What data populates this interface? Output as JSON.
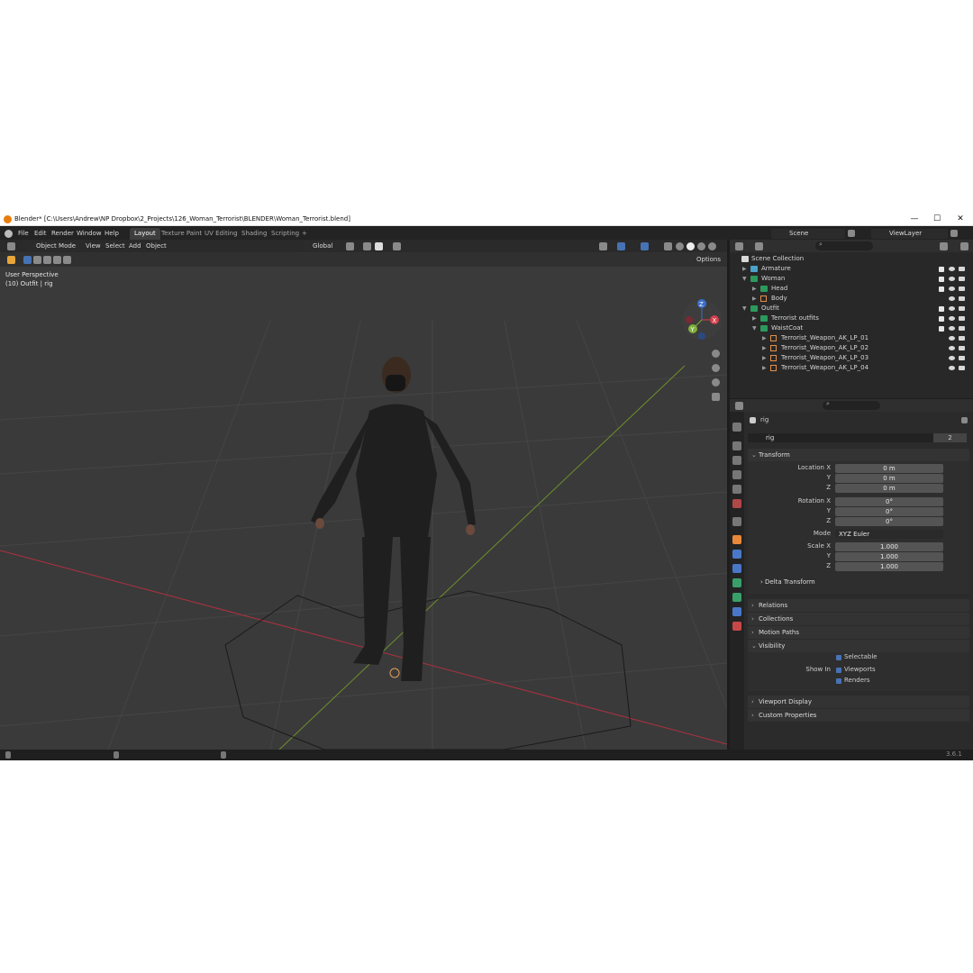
{
  "window": {
    "title": "Blender* [C:\\Users\\Andrew\\NP Dropbox\\2_Projects\\126_Woman_Terrorist\\BLENDER\\Woman_Terrorist.blend]",
    "minimize": "—",
    "maximize": "☐",
    "close": "✕"
  },
  "menubar": {
    "menus": [
      "File",
      "Edit",
      "Render",
      "Window",
      "Help"
    ],
    "tabs": [
      "Layout",
      "Texture Paint",
      "UV Editing",
      "Shading",
      "Scripting"
    ],
    "add_tab": "+",
    "scene": "Scene",
    "view_layer": "ViewLayer"
  },
  "viewport": {
    "mode": "Object Mode",
    "menus": [
      "View",
      "Select",
      "Add",
      "Object"
    ],
    "orientation": "Global",
    "options": "Options",
    "overlay_title": "User Perspective",
    "overlay_sub": "(10) Outfit | rig",
    "gizmo_axes": [
      "X",
      "Y",
      "Z"
    ]
  },
  "outliner": {
    "root": "Scene Collection",
    "items": [
      {
        "label": "Armature",
        "type": "armature"
      },
      {
        "label": "Woman",
        "type": "collection"
      },
      {
        "label": "Head",
        "type": "mesh"
      },
      {
        "label": "Body",
        "type": "mesh"
      },
      {
        "label": "Outfit",
        "type": "collection"
      },
      {
        "label": "Terrorist outfits",
        "type": "mesh"
      },
      {
        "label": "WaistCoat",
        "type": "collection"
      },
      {
        "label": "Terrorist_Weapon_AK_LP_01",
        "type": "mesh"
      },
      {
        "label": "Terrorist_Weapon_AK_LP_02",
        "type": "mesh"
      },
      {
        "label": "Terrorist_Weapon_AK_LP_03",
        "type": "mesh"
      },
      {
        "label": "Terrorist_Weapon_AK_LP_04",
        "type": "mesh"
      }
    ]
  },
  "properties": {
    "object_name": "rig",
    "data_name": "rig",
    "users": "2",
    "transform_title": "Transform",
    "location_x_label": "Location X",
    "rotation_x_label": "Rotation X",
    "scale_x_label": "Scale X",
    "y_label": "Y",
    "z_label": "Z",
    "location": [
      "0 m",
      "0 m",
      "0 m"
    ],
    "rotation": [
      "0°",
      "0°",
      "0°"
    ],
    "mode_label": "Mode",
    "mode_value": "XYZ Euler",
    "scale": [
      "1.000",
      "1.000",
      "1.000"
    ],
    "delta_transform": "Delta Transform",
    "relations": "Relations",
    "collections": "Collections",
    "motion_paths": "Motion Paths",
    "visibility": "Visibility",
    "selectable": "Selectable",
    "show_in": "Show In",
    "viewports": "Viewports",
    "renders": "Renders",
    "viewport_display": "Viewport Display",
    "custom_properties": "Custom Properties"
  },
  "status": {
    "version": "3.6.1"
  },
  "colors": {
    "accent": "#4772b3",
    "mesh_icon": "#e4904b",
    "collection_icon": "#2c9a5c",
    "x_axis": "#d2404c",
    "y_axis": "#7fb03a"
  }
}
